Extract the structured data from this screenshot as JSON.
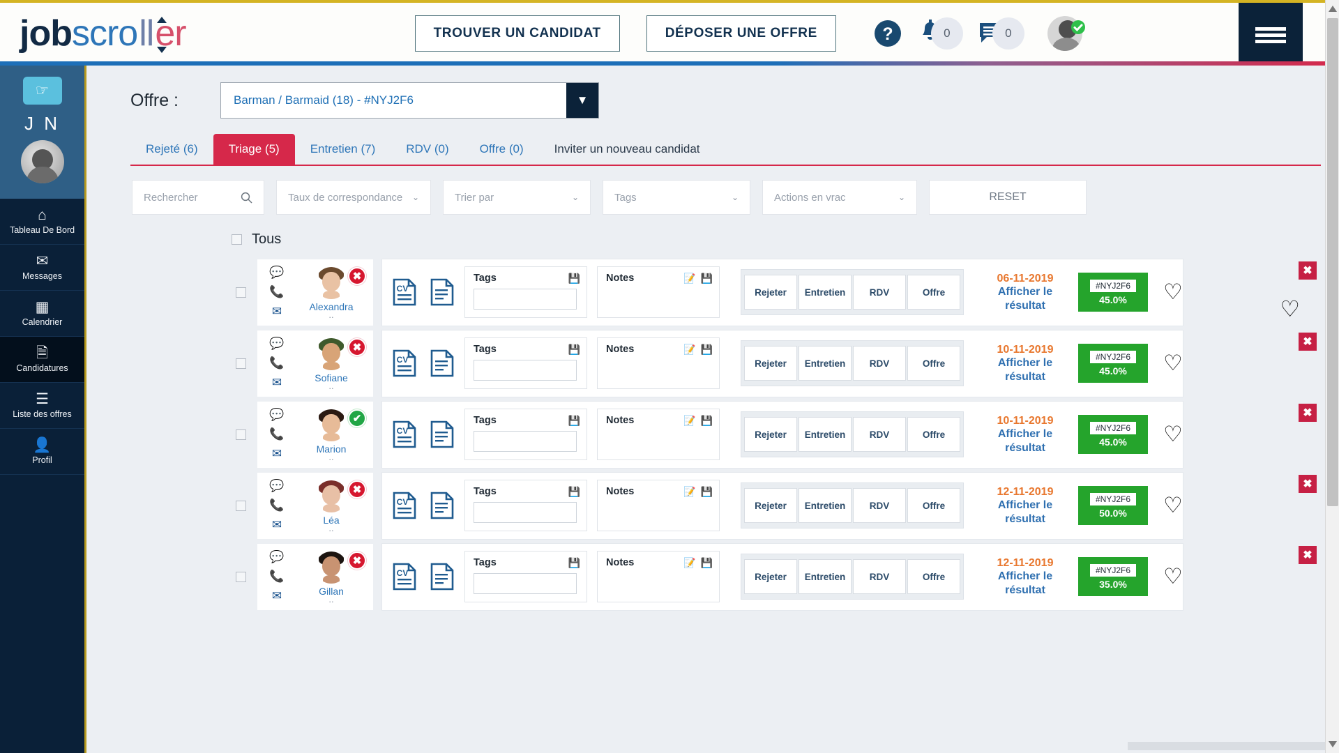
{
  "header": {
    "logo": {
      "part1": "job",
      "part2": "scro",
      "part3": "ll",
      "part4": "er"
    },
    "buttons": {
      "find_candidate": "TROUVER UN CANDIDAT",
      "post_offer": "DÉPOSER UNE OFFRE"
    },
    "icons": {
      "help": "help-circle-icon",
      "bell": "bell-icon",
      "bell_count": "0",
      "messages": "message-icon",
      "messages_count": "0",
      "avatar": "user-avatar",
      "verified": "verified-check-icon",
      "menu": "hamburger-menu-icon"
    }
  },
  "sidebar": {
    "pointer_icon": "☞",
    "initials": "J N",
    "items": [
      {
        "icon": "⌂",
        "label": "Tableau De Bord",
        "active": false
      },
      {
        "icon": "✉",
        "label": "Messages",
        "active": false
      },
      {
        "icon": "▦",
        "label": "Calendrier",
        "active": false
      },
      {
        "icon": "🗎",
        "label": "Candidatures",
        "active": true
      },
      {
        "icon": "☰",
        "label": "Liste des offres",
        "active": false
      },
      {
        "icon": "👤",
        "label": "Profil",
        "active": false
      }
    ]
  },
  "main": {
    "offre_label": "Offre :",
    "offre_value": "Barman / Barmaid (18)  - #NYJ2F6",
    "tabs": [
      {
        "label": "Rejeté (6)",
        "active": false
      },
      {
        "label": "Triage (5)",
        "active": true
      },
      {
        "label": "Entretien (7)",
        "active": false
      },
      {
        "label": "RDV (0)",
        "active": false
      },
      {
        "label": "Offre (0)",
        "active": false
      },
      {
        "label": "Inviter un nouveau candidat",
        "active": false
      }
    ],
    "filters": {
      "search_placeholder": "Rechercher",
      "taux": "Taux de correspondance",
      "trier": "Trier par",
      "tags": "Tags",
      "actions": "Actions en vrac",
      "reset": "RESET"
    },
    "select_all_label": "Tous",
    "box_labels": {
      "tags": "Tags",
      "notes": "Notes"
    },
    "action_buttons": [
      "Rejeter",
      "Entretien",
      "RDV",
      "Offre"
    ],
    "result_link": "Afficher le résultat",
    "candidates": [
      {
        "name": "Alexandra",
        "status": "rejected",
        "date": "06-11-2019",
        "code": "#NYJ2F6",
        "score": "45.0%",
        "hair": "#6b4a2e",
        "skin": "#e9c2a4"
      },
      {
        "name": "Sofiane",
        "status": "rejected",
        "date": "10-11-2019",
        "code": "#NYJ2F6",
        "score": "45.0%",
        "hair": "#3f5a2c",
        "skin": "#d8a477"
      },
      {
        "name": "Marion",
        "status": "approved",
        "date": "10-11-2019",
        "code": "#NYJ2F6",
        "score": "45.0%",
        "hair": "#2b1a12",
        "skin": "#e7bb98"
      },
      {
        "name": "Léa",
        "status": "rejected",
        "date": "12-11-2019",
        "code": "#NYJ2F6",
        "score": "50.0%",
        "hair": "#7a2f2a",
        "skin": "#e8c0a6"
      },
      {
        "name": "Gillan",
        "status": "rejected",
        "date": "12-11-2019",
        "code": "#NYJ2F6",
        "score": "35.0%",
        "hair": "#1c1410",
        "skin": "#c89372"
      }
    ]
  },
  "colors": {
    "accent_red": "#d6284a",
    "brand_navy": "#0a2038",
    "link_blue": "#2e76b8",
    "score_green": "#25a42c",
    "date_orange": "#e8772e",
    "gold_border": "#d4b423"
  }
}
